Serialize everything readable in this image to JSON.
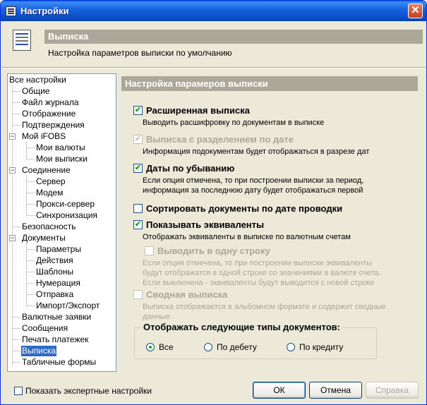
{
  "window": {
    "title": "Настройки",
    "close_label": "✕"
  },
  "header": {
    "title": "Выписка",
    "subtitle": "Настройка параметров выписки по умолчанию"
  },
  "tree": {
    "root": "Все настройки",
    "items": [
      "Общие",
      "Файл журнала",
      "Отображение",
      "Подтверждения",
      "Мой iFOBS",
      "Мои валюты",
      "Мои выписки",
      "Соединение",
      "Сервер",
      "Модем",
      "Прокси-сервер",
      "Синхронизация",
      "Безопасность",
      "Документы",
      "Параметры",
      "Действия",
      "Шаблоны",
      "Нумерация",
      "Отправка",
      "Импорт/Экспорт",
      "Валютные заявки",
      "Сообщения",
      "Печать платежек",
      "Выписка",
      "Табличные формы"
    ],
    "expander_glyph": "−",
    "selected": "Выписка"
  },
  "panel": {
    "heading": "Настройка  парамеров выписки",
    "check_glyph": "✔",
    "options": [
      {
        "label": "Расширенная выписка",
        "checked": true,
        "enabled": true,
        "desc": [
          "Выводить расшифровку по документам в выписке"
        ]
      },
      {
        "label": "Выписка с разделением по дате",
        "checked": true,
        "enabled": false,
        "desc": [
          "Информация подокументам будет отображаться в разрезе дат"
        ]
      },
      {
        "label": "Даты по убыванию",
        "checked": true,
        "enabled": true,
        "desc": [
          "Если опция отмечена, то при построении выписки за период,",
          "информация за последнюю дату будет отображаться первой"
        ]
      },
      {
        "label": "Сортировать документы по дате проводки",
        "checked": false,
        "enabled": true,
        "desc": []
      },
      {
        "label": "Показывать эквиваленты",
        "checked": true,
        "enabled": true,
        "desc": [
          "Отображать эквиваленты в выписке по валютным счетам"
        ]
      },
      {
        "label": "Выводить в одну строку",
        "checked": false,
        "enabled": false,
        "desc": [
          "Если опция отмечена, то при построении выписки эквиваленты",
          "будут отображатся в одной строке со значениями в валюте счета.",
          "Если выключена - эквиваленты будут выводится с новой строки"
        ]
      },
      {
        "label": "Сводная выписка",
        "checked": false,
        "enabled": false,
        "desc": [
          "Выписка отображается в альбомном формате и содержит сводные",
          "данные"
        ]
      }
    ],
    "doc_types": {
      "title": "Отображать следующие типы документов:",
      "radios": [
        "Все",
        "По дебету",
        "По кредиту"
      ],
      "selected": "Все"
    }
  },
  "footer": {
    "expert_label": "Показать экспертные настройки",
    "ok_label": "ОК",
    "cancel_label": "Отмена",
    "help_label": "Справка"
  }
}
